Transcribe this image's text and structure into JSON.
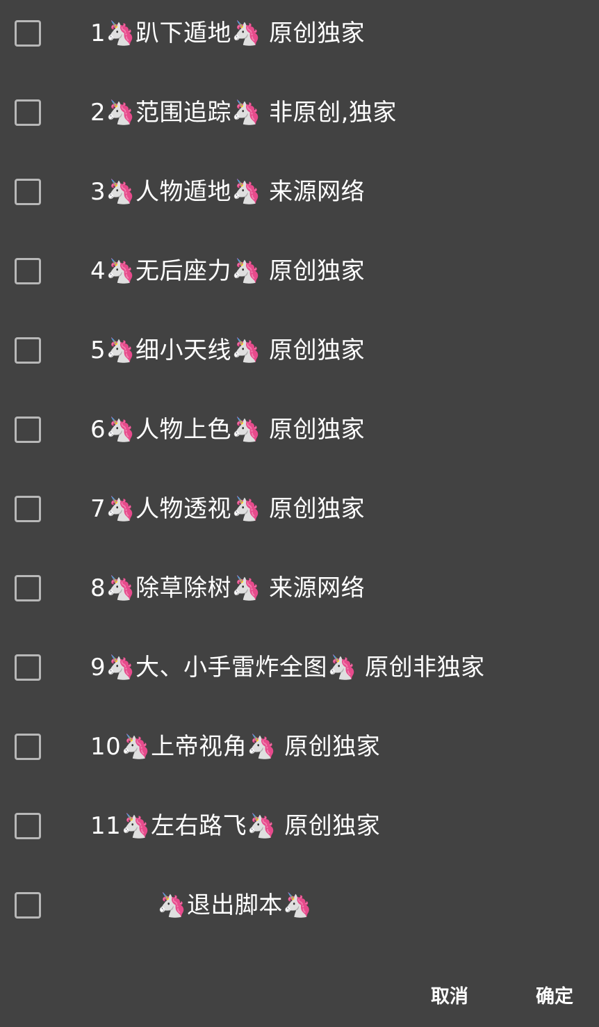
{
  "items": [
    {
      "label": "1🦄趴下遁地🦄 原创独家",
      "checked": false
    },
    {
      "label": "2🦄范围追踪🦄 非原创,独家",
      "checked": false
    },
    {
      "label": "3🦄人物遁地🦄 来源网络",
      "checked": false
    },
    {
      "label": "4🦄无后座力🦄 原创独家",
      "checked": false
    },
    {
      "label": "5🦄细小天线🦄 原创独家",
      "checked": false
    },
    {
      "label": "6🦄人物上色🦄 原创独家",
      "checked": false
    },
    {
      "label": "7🦄人物透视🦄 原创独家",
      "checked": false
    },
    {
      "label": "8🦄除草除树🦄 来源网络",
      "checked": false
    },
    {
      "label": "9🦄大、小手雷炸全图🦄 原创非独家",
      "checked": false
    },
    {
      "label": "10🦄上帝视角🦄 原创独家",
      "checked": false
    },
    {
      "label": "11🦄左右路飞🦄 原创独家",
      "checked": false
    },
    {
      "label": "🦄退出脚本🦄",
      "checked": false
    }
  ],
  "actions": {
    "cancel_label": "取消",
    "ok_label": "确定"
  }
}
